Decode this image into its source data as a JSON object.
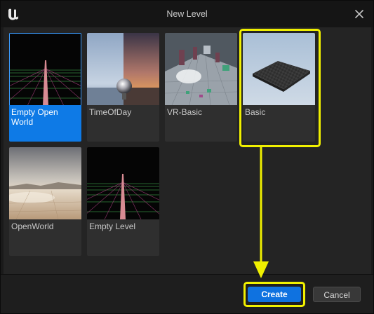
{
  "window": {
    "title": "New Level",
    "icons": {
      "logo": "unreal-engine-logo",
      "close": "close-icon"
    }
  },
  "templates": [
    {
      "label": "Empty Open World",
      "selected": true
    },
    {
      "label": "TimeOfDay",
      "selected": false
    },
    {
      "label": "VR-Basic",
      "selected": false
    },
    {
      "label": "Basic",
      "selected": false,
      "highlighted": true
    },
    {
      "label": "OpenWorld",
      "selected": false
    },
    {
      "label": "Empty Level",
      "selected": false
    }
  ],
  "footer": {
    "create_label": "Create",
    "cancel_label": "Cancel"
  },
  "colors": {
    "selection_blue": "#0e7ae6",
    "annotation_yellow": "#f0f000",
    "primary_button": "#0f72e0"
  }
}
